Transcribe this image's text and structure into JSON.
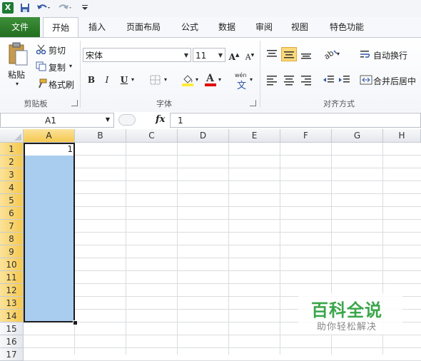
{
  "colors": {
    "file_tab": "#2e7d2a",
    "selection": "#a9cdef",
    "header_selected": "#f5c84e",
    "accent_highlight": "#ffeb3b",
    "font_color_red": "#e00000"
  },
  "tabs": [
    {
      "label": "文件",
      "active": false
    },
    {
      "label": "开始",
      "active": true
    },
    {
      "label": "插入",
      "active": false
    },
    {
      "label": "页面布局",
      "active": false
    },
    {
      "label": "公式",
      "active": false
    },
    {
      "label": "数据",
      "active": false
    },
    {
      "label": "审阅",
      "active": false
    },
    {
      "label": "视图",
      "active": false
    },
    {
      "label": "特色功能",
      "active": false
    }
  ],
  "ribbon": {
    "clipboard": {
      "paste": "粘贴",
      "cut": "剪切",
      "copy": "复制",
      "format_painter": "格式刷",
      "group_label": "剪贴板"
    },
    "font": {
      "font_name": "宋体",
      "font_size": "11",
      "bold": "B",
      "italic": "I",
      "underline": "U",
      "font_color_letter": "A",
      "phonetic": "wén",
      "phonetic_char": "文",
      "group_label": "字体"
    },
    "alignment": {
      "wrap_text": "自动换行",
      "merge_center": "合并后居中",
      "group_label": "对齐方式"
    }
  },
  "formula_bar": {
    "name_box": "A1",
    "fx": "fx",
    "value": "1"
  },
  "columns": [
    "A",
    "B",
    "C",
    "D",
    "E",
    "F",
    "G",
    "H"
  ],
  "rows": [
    "1",
    "2",
    "3",
    "4",
    "5",
    "6",
    "7",
    "8",
    "9",
    "10",
    "11",
    "12",
    "13",
    "14",
    "15",
    "16",
    "17"
  ],
  "cells": {
    "A1": "1"
  },
  "selection": {
    "range": "A1:A14",
    "active_cell": "A1"
  },
  "watermark": {
    "title": "百科全说",
    "subtitle": "助你轻松解决"
  }
}
